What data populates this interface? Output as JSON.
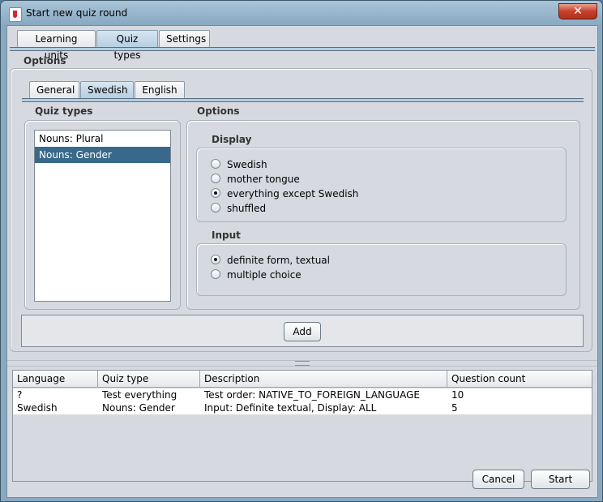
{
  "window": {
    "title": "Start new quiz round",
    "close_glyph": "✕"
  },
  "main_tabs": [
    {
      "label": "Learning units",
      "active": false
    },
    {
      "label": "Quiz types",
      "active": true
    },
    {
      "label": "Settings",
      "active": false
    }
  ],
  "options": {
    "title": "Options",
    "lang_tabs": [
      {
        "label": "General",
        "active": false
      },
      {
        "label": "Swedish",
        "active": true
      },
      {
        "label": "English",
        "active": false
      }
    ],
    "quiz_types": {
      "title": "Quiz types",
      "items": [
        "Nouns: Plural",
        "Nouns: Gender"
      ],
      "selected": "Nouns: Gender"
    },
    "inner_options_title": "Options",
    "display": {
      "title": "Display",
      "choices": [
        "Swedish",
        "mother tongue",
        "everything except Swedish",
        "shuffled"
      ],
      "selected": "everything except Swedish"
    },
    "input": {
      "title": "Input",
      "choices": [
        "definite form, textual",
        "multiple choice"
      ],
      "selected": "definite form, textual"
    },
    "add_label": "Add"
  },
  "table": {
    "columns": [
      "Language",
      "Quiz type",
      "Description",
      "Question count"
    ],
    "rows": [
      [
        "?",
        "Test everything",
        "Test order: NATIVE_TO_FOREIGN_LANGUAGE",
        "10"
      ],
      [
        "Swedish",
        "Nouns: Gender",
        "Input: Definite textual, Display: ALL",
        "5"
      ]
    ]
  },
  "footer": {
    "cancel_label": "Cancel",
    "start_label": "Start"
  }
}
